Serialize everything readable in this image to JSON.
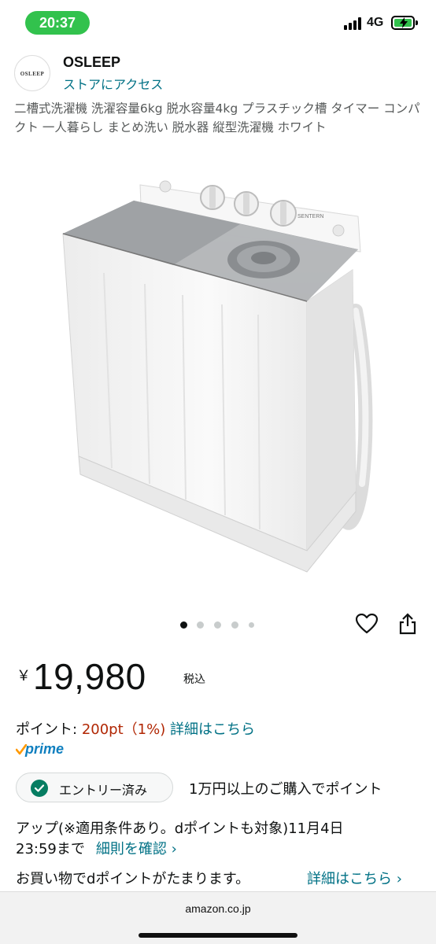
{
  "status_bar": {
    "time": "20:37",
    "network": "4G",
    "battery_color": "#32c24d",
    "icons": [
      "signal-icon",
      "battery-charging-icon"
    ]
  },
  "store": {
    "logo_text": "OSLEEP",
    "name": "OSLEEP",
    "link": "ストアにアクセス"
  },
  "product": {
    "title": "二槽式洗濯機 洗濯容量6kg 脱水容量4kg プラスチック槽 タイマー コンパクト 一人暮らし まとめ洗い 脱水器 縦型洗濯機 ホワイト",
    "image_label": "SENTERN",
    "image_count": 5,
    "image_index": 1
  },
  "price": {
    "currency": "￥",
    "amount": "19,980",
    "tax_note": "税込"
  },
  "points": {
    "label": "ポイント:",
    "value": "200pt（1%)",
    "detail_link": "詳細はこちら"
  },
  "prime": {
    "label": "prime",
    "color": "#0f7fbf"
  },
  "promotion": {
    "entry_button": "エントリー済み",
    "line1": "1万円以上のご購入でポイント",
    "line2": "アップ(※適用条件あり。dポイントも対象)11月4日",
    "line3": "23:59まで",
    "rules_link": "細則を確認 ›"
  },
  "dpoint": {
    "text": "お買い物でdポイントがたまります。",
    "link": "詳細はこちら ›"
  },
  "browser": {
    "url": "amazon.co.jp"
  },
  "colors": {
    "link": "#007185",
    "price_red": "#b12704",
    "accent_green": "#067d62"
  }
}
